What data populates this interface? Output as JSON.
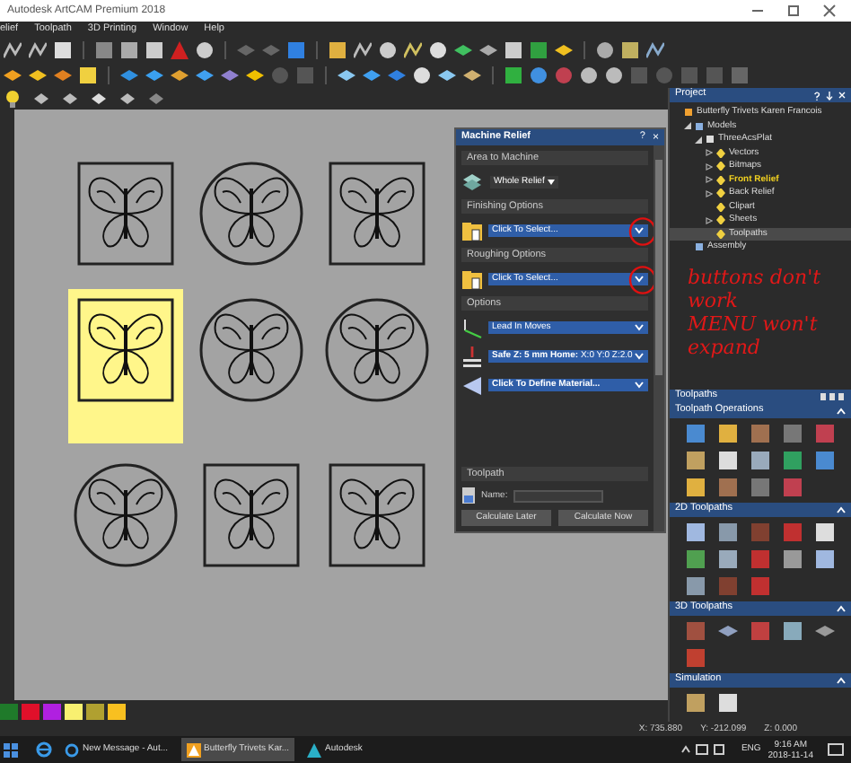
{
  "window": {
    "title": "Autodesk ArtCAM Premium 2018"
  },
  "menu": [
    "elief",
    "Toolpath",
    "3D Printing",
    "Window",
    "Help"
  ],
  "tiles": [
    {
      "kind": "square",
      "selected": false
    },
    {
      "kind": "circle",
      "selected": false
    },
    {
      "kind": "square",
      "selected": false
    },
    {
      "kind": "square",
      "selected": true
    },
    {
      "kind": "circle",
      "selected": false
    },
    {
      "kind": "circle",
      "selected": false
    },
    {
      "kind": "circle",
      "selected": false
    },
    {
      "kind": "square",
      "selected": false
    },
    {
      "kind": "square",
      "selected": false
    }
  ],
  "machine_relief": {
    "title": "Machine Relief",
    "help": "?",
    "close": "×",
    "area_heading": "Area to Machine",
    "area_value": "Whole Relief",
    "finishing_heading": "Finishing Options",
    "finishing_value": "Click To Select...",
    "roughing_heading": "Roughing Options",
    "roughing_value": "Click To Select...",
    "options_heading": "Options",
    "options": [
      {
        "label": "Lead In Moves"
      },
      {
        "label": "**Safe Z: 5 mm Home:** X:0 Y:0 Z:2.0"
      },
      {
        "label": "**Click To Define Material...**"
      }
    ],
    "toolpath_heading": "Toolpath",
    "name_label": "Name:",
    "buttons": [
      "Calculate Later",
      "Calculate Now"
    ]
  },
  "project": {
    "title": "Project",
    "tree": [
      {
        "label": "Butterfly Trivets Karen Francois",
        "selected": false,
        "children": [
          {
            "label": "Models",
            "expanded": true,
            "selected": false,
            "children": [
              {
                "label": "ThreeAcsPlat",
                "expanded": true,
                "selected": false,
                "children": [
                  {
                    "label": "Vectors",
                    "expanded": false,
                    "selected": false,
                    "active": false
                  },
                  {
                    "label": "Bitmaps",
                    "expanded": false,
                    "selected": false,
                    "active": false
                  },
                  {
                    "label": "Front Relief",
                    "expanded": false,
                    "selected": false,
                    "active": true
                  },
                  {
                    "label": "Back Relief",
                    "expanded": false,
                    "selected": false,
                    "active": false
                  },
                  {
                    "label": "Clipart",
                    "selected": false,
                    "active": false
                  },
                  {
                    "label": "Sheets",
                    "expanded": false,
                    "selected": false,
                    "active": false
                  },
                  {
                    "label": "Toolpaths",
                    "selected": true,
                    "active": false
                  }
                ]
              }
            ]
          },
          {
            "label": "Assembly",
            "selected": false
          }
        ]
      }
    ]
  },
  "annotation": [
    "buttons don't",
    "work",
    "MENU won't",
    "expand"
  ],
  "toolpaths": {
    "title": "Toolpaths",
    "sections": [
      {
        "title": "Toolpath Operations",
        "expanded": true
      },
      {
        "title": "2D Toolpaths",
        "expanded": true
      },
      {
        "title": "3D Toolpaths",
        "expanded": true
      },
      {
        "title": "Simulation",
        "expanded": true
      }
    ]
  },
  "palette": [
    {
      "color": "#1f7a2a"
    },
    {
      "color": "#e0102a"
    },
    {
      "color": "#b020e0"
    },
    {
      "color": "#f8f070"
    },
    {
      "color": "#b0a030"
    },
    {
      "color": "#f8c020"
    }
  ],
  "coordinates": [
    "X: 735.880",
    "Y: -212.099",
    "Z: 0.000"
  ],
  "taskbar": {
    "apps": [
      {
        "label": "New Message - Aut...",
        "selected": false
      },
      {
        "label": "Butterfly Trivets Kar...",
        "selected": true
      },
      {
        "label": "Autodesk",
        "selected": false
      }
    ],
    "language": "ENG",
    "time": "9:16 AM",
    "date": "2018-11-14"
  }
}
